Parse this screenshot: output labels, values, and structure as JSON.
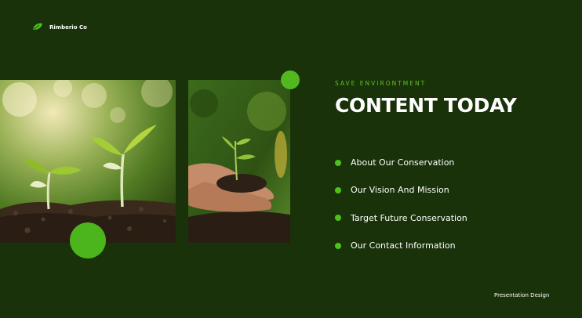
{
  "brand": {
    "name": "Rimberio Co",
    "icon": "leaf-icon"
  },
  "hero": {
    "eyebrow": "SAVE ENVIRONTMENT",
    "title": "CONTENT TODAY"
  },
  "agenda": {
    "items": [
      {
        "label": "About Our Conservation"
      },
      {
        "label": "Our Vision And Mission"
      },
      {
        "label": "Target Future Conservation"
      },
      {
        "label": "Our Contact Information"
      }
    ]
  },
  "footer": {
    "label": "Presentation Design"
  },
  "colors": {
    "background": "#1a3209",
    "accent": "#4cb51b",
    "eyebrow": "#5fc322",
    "text": "#ffffff"
  }
}
